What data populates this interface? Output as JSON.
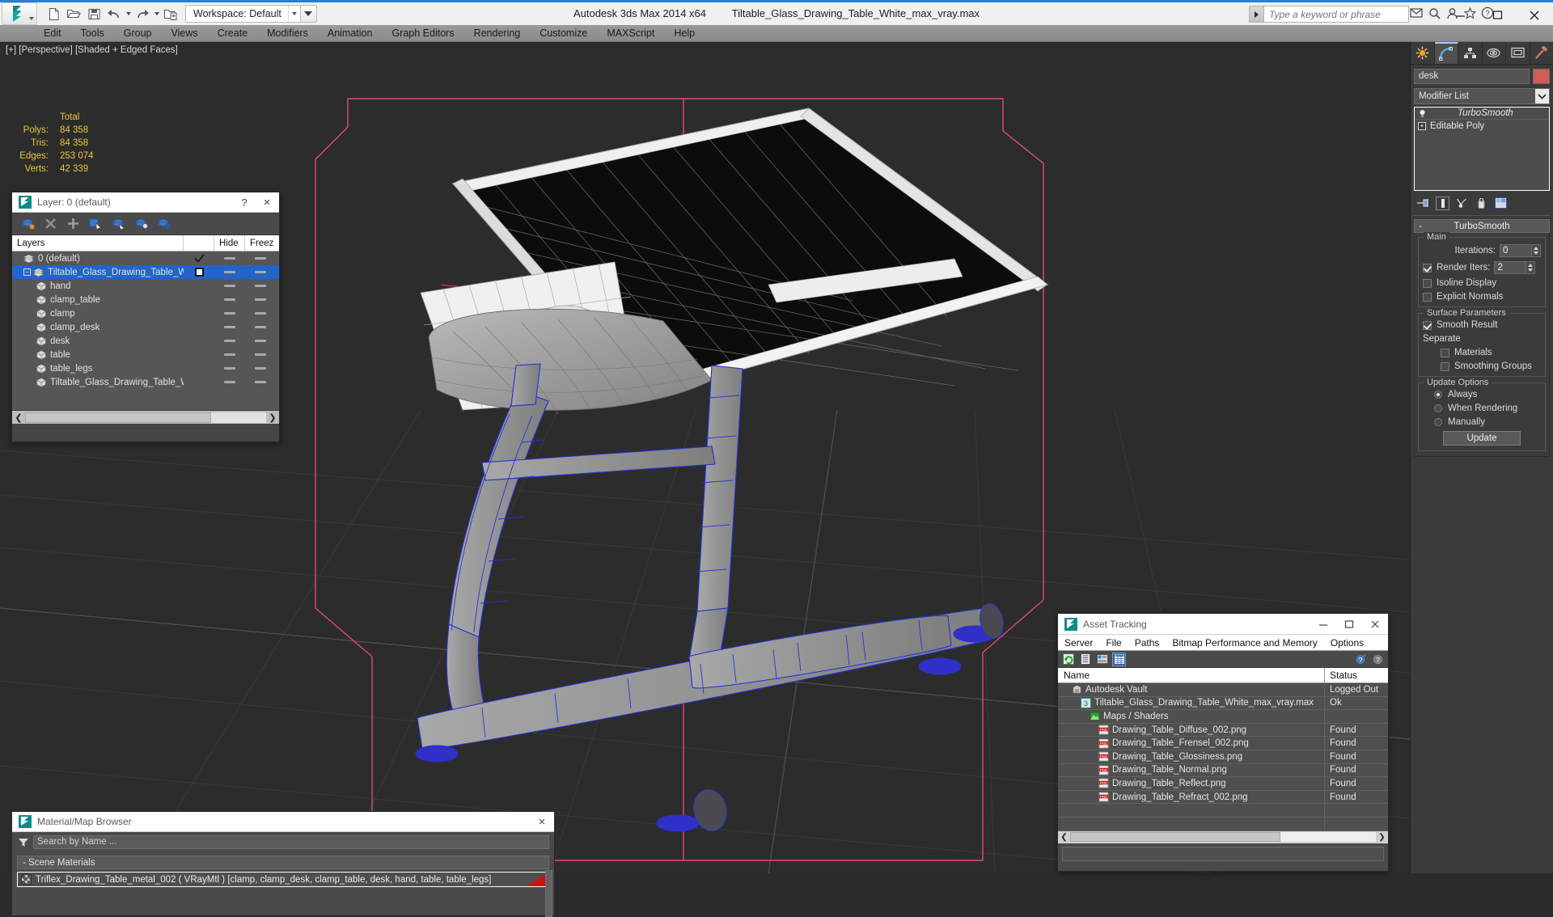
{
  "app": {
    "title": "Autodesk 3ds Max  2014 x64",
    "file": "Tiltable_Glass_Drawing_Table_White_max_vray.max"
  },
  "quick_access": {
    "workspace_label": "Workspace: Default",
    "buttons": [
      "new-icon",
      "open-icon",
      "save-icon",
      "undo-icon",
      "redo-icon",
      "set-project-icon"
    ]
  },
  "search": {
    "placeholder": "Type a keyword or phrase"
  },
  "window_controls": {
    "minimize": "minimize-icon",
    "maximize": "maximize-icon",
    "close": "close-icon"
  },
  "menubar": {
    "items": [
      "Edit",
      "Tools",
      "Group",
      "Views",
      "Create",
      "Modifiers",
      "Animation",
      "Graph Editors",
      "Rendering",
      "Customize",
      "MAXScript",
      "Help"
    ]
  },
  "viewport": {
    "label": "[+] [Perspective] [Shaded + Edged Faces]",
    "stats": {
      "header": "Total",
      "rows": [
        {
          "key": "Polys:",
          "value": "84 358"
        },
        {
          "key": "Tris:",
          "value": "84 358"
        },
        {
          "key": "Edges:",
          "value": "253 074"
        },
        {
          "key": "Verts:",
          "value": "42 339"
        }
      ]
    }
  },
  "layer_dialog": {
    "title": "Layer: 0 (default)",
    "help": "?",
    "close": "×",
    "columns": [
      "Layers",
      "",
      "Hide",
      "Freez"
    ],
    "rows": [
      {
        "label": "0 (default)",
        "type": "layer",
        "indent": 0,
        "selected": false,
        "check": "tick",
        "expander": false
      },
      {
        "label": "Tiltable_Glass_Drawing_Table_White",
        "type": "layer",
        "indent": 0,
        "selected": true,
        "check": "empty",
        "expander": true
      },
      {
        "label": "hand",
        "type": "object",
        "indent": 1,
        "selected": false,
        "check": "none",
        "expander": false
      },
      {
        "label": "clamp_table",
        "type": "object",
        "indent": 1,
        "selected": false,
        "check": "none",
        "expander": false
      },
      {
        "label": "clamp",
        "type": "object",
        "indent": 1,
        "selected": false,
        "check": "none",
        "expander": false
      },
      {
        "label": "clamp_desk",
        "type": "object",
        "indent": 1,
        "selected": false,
        "check": "none",
        "expander": false
      },
      {
        "label": "desk",
        "type": "object",
        "indent": 1,
        "selected": false,
        "check": "none",
        "expander": false
      },
      {
        "label": "table",
        "type": "object",
        "indent": 1,
        "selected": false,
        "check": "none",
        "expander": false
      },
      {
        "label": "table_legs",
        "type": "object",
        "indent": 1,
        "selected": false,
        "check": "none",
        "expander": false
      },
      {
        "label": "Tiltable_Glass_Drawing_Table_White",
        "type": "object",
        "indent": 1,
        "selected": false,
        "check": "none",
        "expander": false
      }
    ],
    "toolbar_icons": [
      "new-layer-icon",
      "delete-layer-icon",
      "add-selection-icon",
      "select-objects-in-layer-icon",
      "select-highlighted-objects-icon",
      "highlight-selected-objects-icon",
      "layer-properties-icon"
    ]
  },
  "material_browser": {
    "title": "Material/Map Browser",
    "close": "×",
    "search_placeholder": "Search by Name ...",
    "group": "-  Scene Materials",
    "item": "Triflex_Drawing_Table_metal_002  ( VRayMtl ) [clamp, clamp_desk, clamp_table, desk, hand, table, table_legs]"
  },
  "asset_tracking": {
    "title": "Asset Tracking",
    "menus": [
      "Server",
      "File",
      "Paths",
      "Bitmap Performance and Memory",
      "Options"
    ],
    "toolbar_icons": [
      "refresh-icon",
      "list-view-icon",
      "detail-view-icon",
      "grid-view-icon"
    ],
    "toolbar_right_icons": [
      "help-add-icon",
      "help-icon"
    ],
    "columns": [
      "Name",
      "Status"
    ],
    "rows": [
      {
        "name": "Autodesk Vault",
        "status": "Logged Out",
        "indent": 1,
        "icon": "vault-icon"
      },
      {
        "name": "Tiltable_Glass_Drawing_Table_White_max_vray.max",
        "status": "Ok",
        "indent": 2,
        "icon": "max-file-icon"
      },
      {
        "name": "Maps / Shaders",
        "status": "",
        "indent": 3,
        "icon": "maps-icon"
      },
      {
        "name": "Drawing_Table_Diffuse_002.png",
        "status": "Found",
        "indent": 4,
        "icon": "png-icon"
      },
      {
        "name": "Drawing_Table_Frensel_002.png",
        "status": "Found",
        "indent": 4,
        "icon": "png-icon"
      },
      {
        "name": "Drawing_Table_Glossiness.png",
        "status": "Found",
        "indent": 4,
        "icon": "png-icon"
      },
      {
        "name": "Drawing_Table_Normal.png",
        "status": "Found",
        "indent": 4,
        "icon": "png-icon"
      },
      {
        "name": "Drawing_Table_Reflect.png",
        "status": "Found",
        "indent": 4,
        "icon": "png-icon"
      },
      {
        "name": "Drawing_Table_Refract_002.png",
        "status": "Found",
        "indent": 4,
        "icon": "png-icon"
      },
      {
        "name": "",
        "status": "",
        "indent": 0,
        "icon": "none"
      },
      {
        "name": "",
        "status": "",
        "indent": 0,
        "icon": "none"
      }
    ]
  },
  "command_panel": {
    "tabs": [
      "create-tab-icon",
      "modify-tab-icon",
      "hierarchy-tab-icon",
      "motion-tab-icon",
      "display-tab-icon",
      "utilities-tab-icon"
    ],
    "active_tab_index": 1,
    "object_name": "desk",
    "object_color": "#d05c55",
    "modifier_list_label": "Modifier List",
    "stack": [
      {
        "label": "TurboSmooth",
        "italic": true,
        "icon": "light-bulb-icon"
      },
      {
        "label": "Editable Poly",
        "italic": false,
        "icon": "expand-plus-icon"
      }
    ],
    "stack_tools": [
      "pin-stack-icon",
      "show-end-result-icon",
      "make-unique-icon",
      "remove-modifier-icon",
      "configure-modifier-sets-icon"
    ],
    "rollup": {
      "title": "TurboSmooth",
      "collapse_marker": "-",
      "groups": [
        {
          "label": "Main",
          "fields": [
            {
              "kind": "spinner",
              "label": "Iterations:",
              "value": "0",
              "checkbox": null
            },
            {
              "kind": "spinner",
              "label": "Render Iters:",
              "value": "2",
              "checkbox": true
            },
            {
              "kind": "checkbox",
              "label": "Isoline Display",
              "checked": false
            },
            {
              "kind": "checkbox",
              "label": "Explicit Normals",
              "checked": false
            }
          ]
        },
        {
          "label": "Surface Parameters",
          "fields": [
            {
              "kind": "checkbox",
              "label": "Smooth Result",
              "checked": true
            },
            {
              "kind": "text",
              "label": "Separate"
            },
            {
              "kind": "checkbox",
              "label": "Materials",
              "checked": false,
              "indent": true
            },
            {
              "kind": "checkbox",
              "label": "Smoothing Groups",
              "checked": false,
              "indent": true
            }
          ]
        },
        {
          "label": "Update Options",
          "fields": [
            {
              "kind": "radio",
              "label": "Always",
              "checked": true
            },
            {
              "kind": "radio",
              "label": "When Rendering",
              "checked": false
            },
            {
              "kind": "radio",
              "label": "Manually",
              "checked": false
            },
            {
              "kind": "button",
              "label": "Update"
            }
          ]
        }
      ]
    }
  },
  "colors": {
    "accent_blue": "#2a7fd4",
    "selection_blue": "#2364c8",
    "stats_yellow": "#e8c63c",
    "gizmo_pink": "#e0487f",
    "wire_blue": "#2430d8",
    "viewport_bg": "#2c2c2c"
  }
}
